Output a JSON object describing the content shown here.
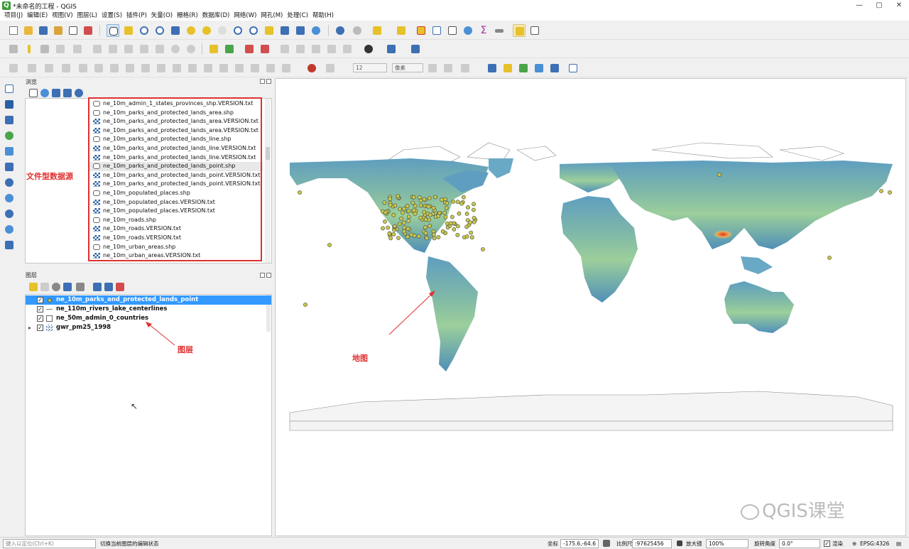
{
  "window": {
    "title": "*未命名的工程 - QGIS",
    "minimize": "—",
    "maximize": "▢",
    "close": "✕"
  },
  "menu": [
    "项目(J)",
    "编辑(E)",
    "视图(V)",
    "图层(L)",
    "设置(S)",
    "插件(P)",
    "矢量(O)",
    "栅格(R)",
    "数据库(D)",
    "网络(W)",
    "网孔(M)",
    "处理(C)",
    "帮助(H)"
  ],
  "digitize_toolbar": {
    "snap_tolerance": "12",
    "snap_units": "像素"
  },
  "browser_panel": {
    "title": "浏览",
    "files": [
      {
        "name": "ne_10m_admin_1_states_provinces_shp.VERSION.txt",
        "kind": "vector"
      },
      {
        "name": "ne_10m_parks_and_protected_lands_area.shp",
        "kind": "vector"
      },
      {
        "name": "ne_10m_parks_and_protected_lands_area.VERSION.txt",
        "kind": "raster"
      },
      {
        "name": "ne_10m_parks_and_protected_lands_area.VERSION.txt",
        "kind": "raster"
      },
      {
        "name": "ne_10m_parks_and_protected_lands_line.shp",
        "kind": "vector"
      },
      {
        "name": "ne_10m_parks_and_protected_lands_line.VERSION.txt",
        "kind": "raster"
      },
      {
        "name": "ne_10m_parks_and_protected_lands_line.VERSION.txt",
        "kind": "raster"
      },
      {
        "name": "ne_10m_parks_and_protected_lands_point.shp",
        "kind": "vector",
        "selected": true
      },
      {
        "name": "ne_10m_parks_and_protected_lands_point.VERSION.txt",
        "kind": "raster"
      },
      {
        "name": "ne_10m_parks_and_protected_lands_point.VERSION.txt",
        "kind": "raster"
      },
      {
        "name": "ne_10m_populated_places.shp",
        "kind": "vector"
      },
      {
        "name": "ne_10m_populated_places.VERSION.txt",
        "kind": "raster"
      },
      {
        "name": "ne_10m_populated_places.VERSION.txt",
        "kind": "raster"
      },
      {
        "name": "ne_10m_roads.shp",
        "kind": "vector"
      },
      {
        "name": "ne_10m_roads.VERSION.txt",
        "kind": "raster"
      },
      {
        "name": "ne_10m_roads.VERSION.txt",
        "kind": "raster"
      },
      {
        "name": "ne_10m_urban_areas.shp",
        "kind": "vector"
      },
      {
        "name": "ne_10m_urban_areas.VERSION.txt",
        "kind": "raster"
      }
    ]
  },
  "layers_panel": {
    "title": "图层",
    "layers": [
      {
        "name": "ne_10m_parks_and_protected_lands_point",
        "checked": true,
        "selected": true
      },
      {
        "name": "ne_110m_rivers_lake_centerlines",
        "checked": true
      },
      {
        "name": "ne_50m_admin_0_countries",
        "checked": true
      },
      {
        "name": "gwr_pm25_1998",
        "checked": true,
        "expandable": true
      }
    ]
  },
  "annotations": {
    "file_data_source": "文件型数据源",
    "layers": "图层",
    "map": "地图"
  },
  "watermark": "QGIS课堂",
  "status": {
    "locator_placeholder": "键入以定位(Ctrl+K)",
    "message": "切换当前图层的编辑状态",
    "coordinate_label": "坐标",
    "coordinate": "-175.6,-64.6",
    "scale_label": "比例尺",
    "scale": ":97625456",
    "magnifier_label": "放大镜",
    "magnifier": "100%",
    "rotation_label": "旋转角度",
    "rotation": "0.0°",
    "render_label": "渲染",
    "crs": "EPSG:4326"
  },
  "colors": {
    "selection": "#3399ff",
    "annotation_red": "#e03030",
    "park_point_fill": "#c9c94b"
  }
}
